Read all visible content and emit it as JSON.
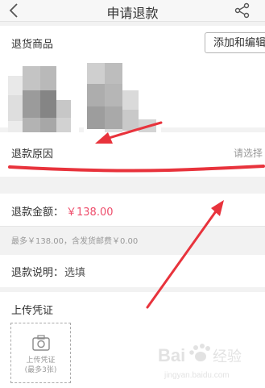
{
  "header": {
    "title": "申请退款",
    "back_icon": "chevron-left-icon",
    "share_icon": "share-icon"
  },
  "goods": {
    "label": "退货商品",
    "add_edit_button": "添加和编辑"
  },
  "reason": {
    "label": "退款原因",
    "placeholder": "请选择"
  },
  "amount": {
    "label": "退款金额：",
    "value": "￥138.00",
    "value_color": "#ee4d6b"
  },
  "amount_note": "最多￥138.00，含发货邮费￥0.00",
  "description": {
    "label": "退款说明：",
    "placeholder": "选填"
  },
  "upload": {
    "section_title": "上传凭证",
    "box_title": "上传凭证",
    "box_limit": "(最多3张)",
    "icon": "camera-icon"
  },
  "annotation": {
    "arrow_color": "#e8333c",
    "underline_color": "#e8333c"
  },
  "watermark": {
    "brand": "Bai",
    "brand_suffix": "经验",
    "domain": "jingyan.baidu.com"
  }
}
